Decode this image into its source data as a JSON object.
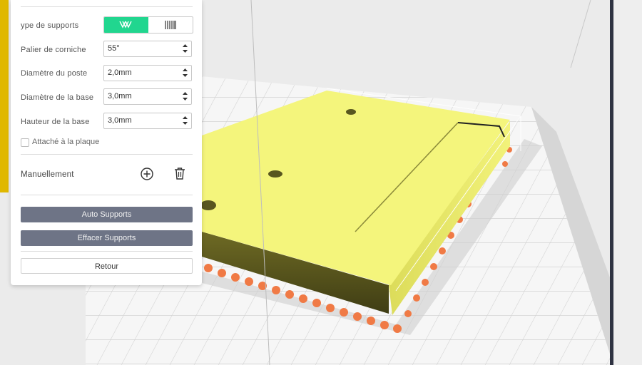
{
  "panel": {
    "support_type": {
      "label": "ype de supports",
      "options": [
        {
          "name": "tree-supports-icon",
          "selected": true
        },
        {
          "name": "grid-supports-icon",
          "selected": false
        }
      ]
    },
    "fields": [
      {
        "label": "Palier de corniche",
        "value": "55°"
      },
      {
        "label": "Diamètre du poste",
        "value": "2,0mm"
      },
      {
        "label": "Diamètre de la base",
        "value": "3,0mm"
      },
      {
        "label": "Hauteur de la base",
        "value": "3,0mm"
      }
    ],
    "attach_checkbox": {
      "label": "Attaché à la plaque",
      "checked": false
    },
    "manual": {
      "label": "Manuellement",
      "add_icon": "add-circle-icon",
      "delete_icon": "trash-icon"
    },
    "buttons": {
      "auto": "Auto Supports",
      "clear": "Effacer Supports",
      "back": "Retour"
    }
  },
  "colors": {
    "accent": "#21d68f",
    "button_dark": "#6e7486",
    "model": "#f4f57c",
    "supports": "#f07a45",
    "bed": "#f4f4f4"
  }
}
